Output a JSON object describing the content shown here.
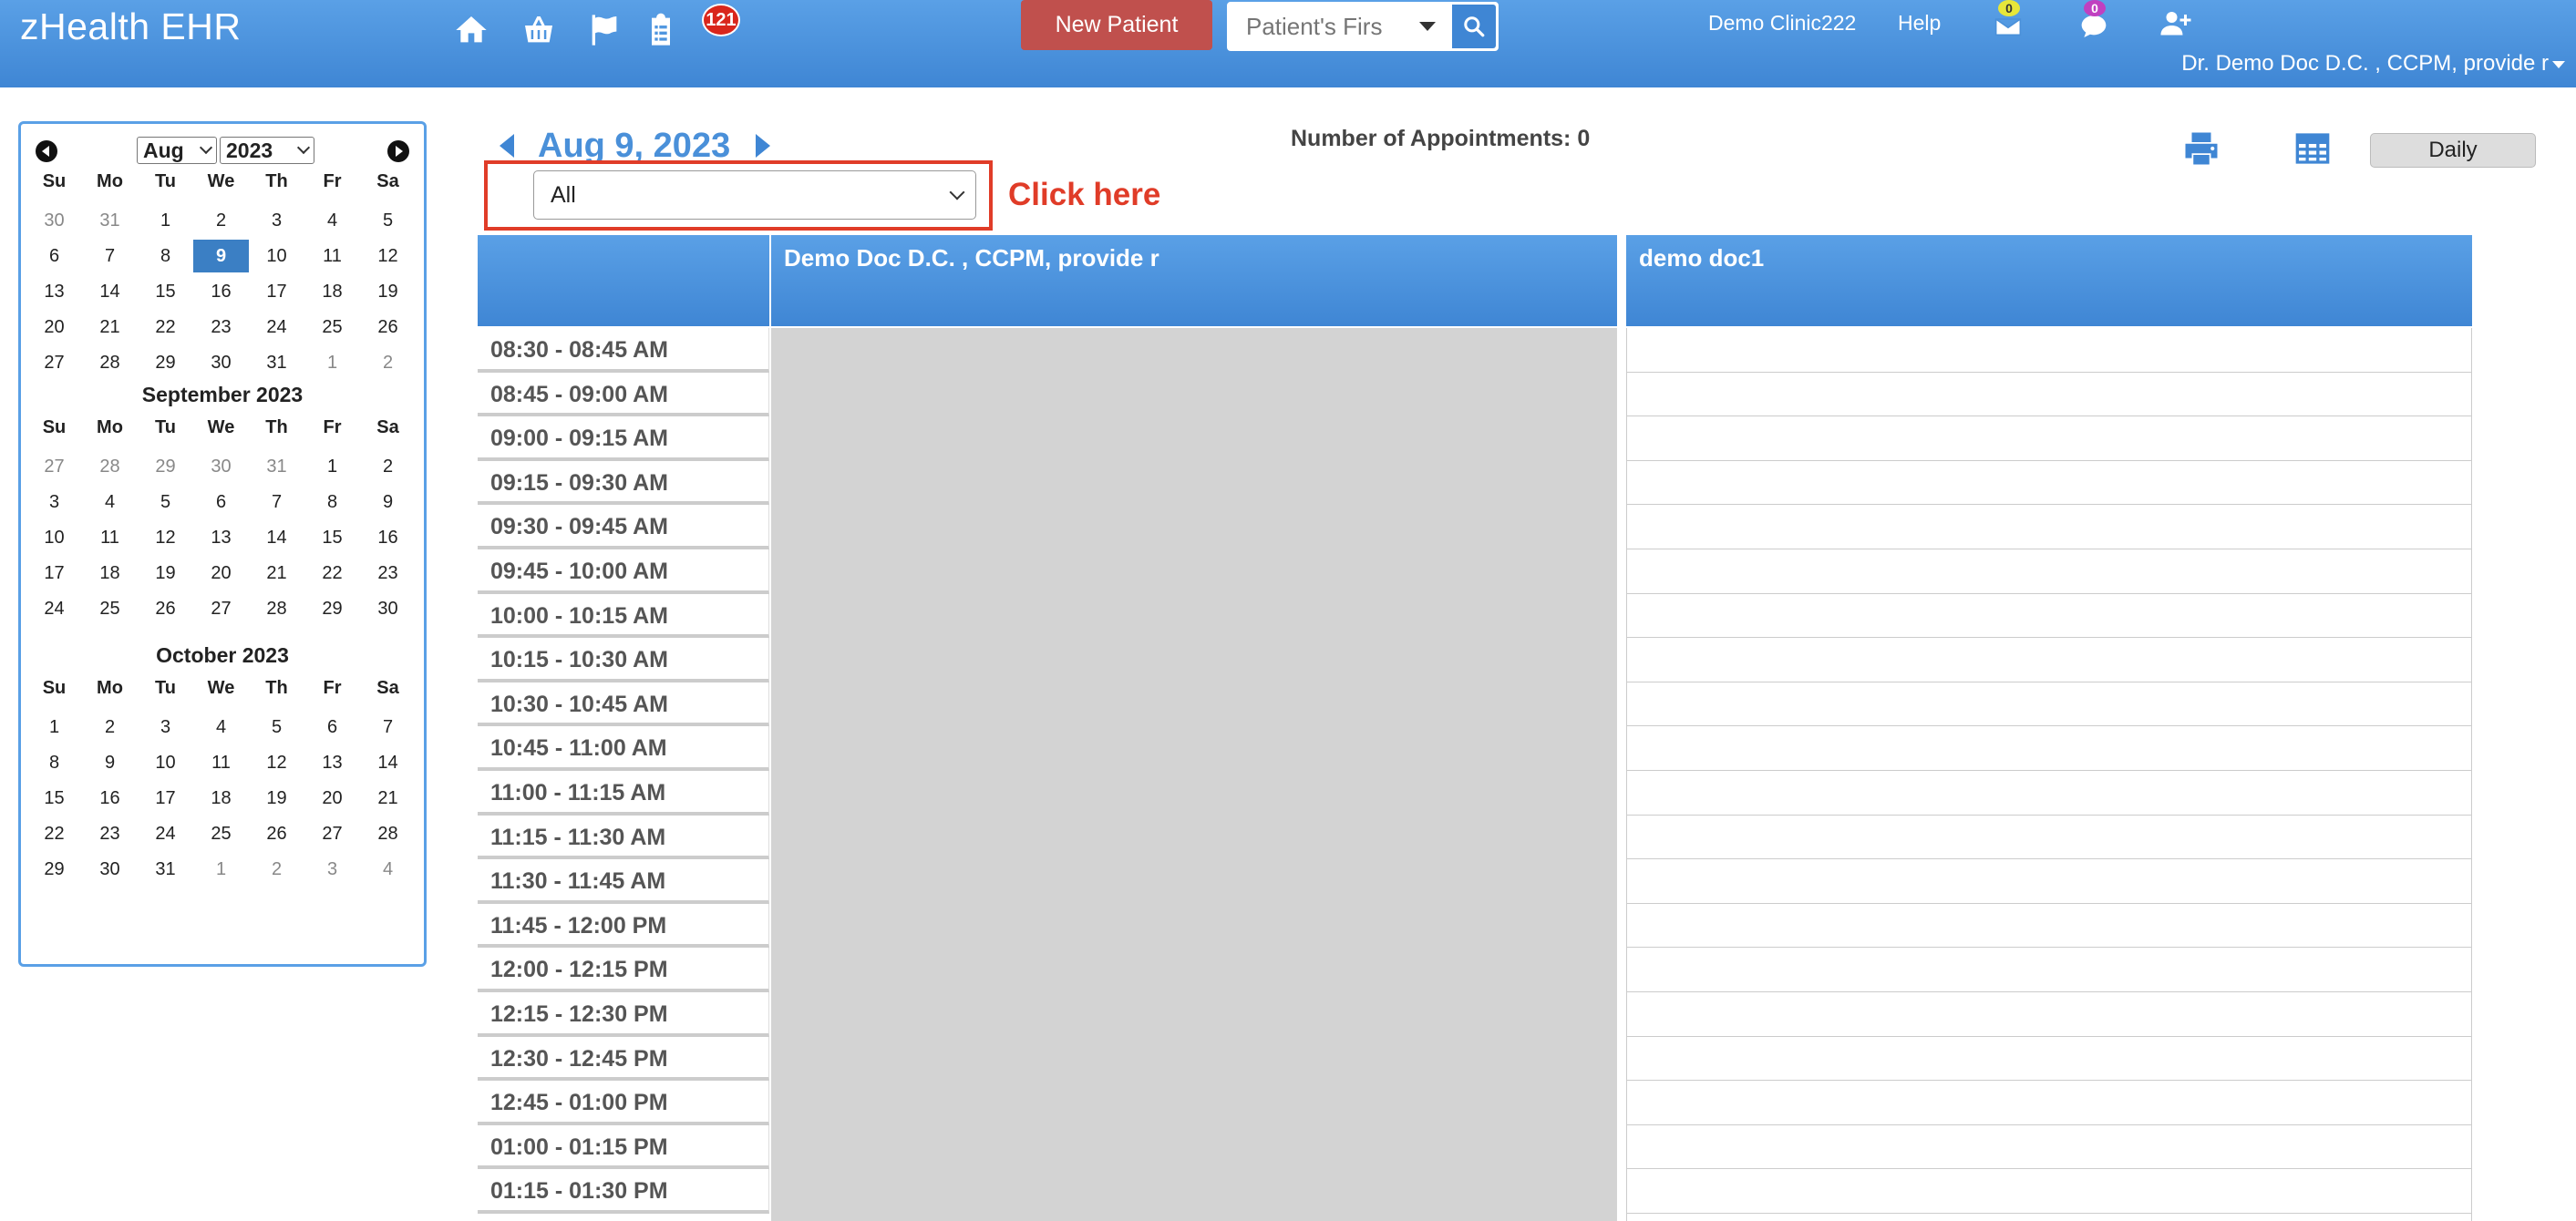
{
  "header": {
    "brand": "zHealth EHR",
    "notification_badge": "121",
    "new_patient_label": "New Patient",
    "search_placeholder": "Patient's Firs",
    "clinic": "Demo Clinic222",
    "help": "Help",
    "mail_badge": "0",
    "chat_badge": "0",
    "user": "Dr. Demo Doc D.C. , CCPM, provide r",
    "colors": {
      "bar": "#4a90d9",
      "new_patient": "#c0504d",
      "badge": "#d9261c"
    },
    "icons": [
      "home-icon",
      "basket-icon",
      "flag-icon",
      "clipboard-icon",
      "mail-icon",
      "chat-icon",
      "add-user-icon",
      "search-icon"
    ]
  },
  "mini_calendar": {
    "selected_month": "Aug",
    "selected_year": "2023",
    "dow": [
      "Su",
      "Mo",
      "Tu",
      "We",
      "Th",
      "Fr",
      "Sa"
    ],
    "months": [
      {
        "title": "",
        "weeks": [
          [
            {
              "d": "30",
              "m": 1
            },
            {
              "d": "31",
              "m": 1
            },
            {
              "d": "1"
            },
            {
              "d": "2"
            },
            {
              "d": "3"
            },
            {
              "d": "4"
            },
            {
              "d": "5"
            }
          ],
          [
            {
              "d": "6"
            },
            {
              "d": "7"
            },
            {
              "d": "8"
            },
            {
              "d": "9",
              "sel": 1
            },
            {
              "d": "10"
            },
            {
              "d": "11"
            },
            {
              "d": "12"
            }
          ],
          [
            {
              "d": "13"
            },
            {
              "d": "14"
            },
            {
              "d": "15"
            },
            {
              "d": "16"
            },
            {
              "d": "17"
            },
            {
              "d": "18"
            },
            {
              "d": "19"
            }
          ],
          [
            {
              "d": "20"
            },
            {
              "d": "21"
            },
            {
              "d": "22"
            },
            {
              "d": "23"
            },
            {
              "d": "24"
            },
            {
              "d": "25"
            },
            {
              "d": "26"
            }
          ],
          [
            {
              "d": "27"
            },
            {
              "d": "28"
            },
            {
              "d": "29"
            },
            {
              "d": "30"
            },
            {
              "d": "31"
            },
            {
              "d": "1",
              "m": 1
            },
            {
              "d": "2",
              "m": 1
            }
          ]
        ]
      },
      {
        "title": "September 2023",
        "weeks": [
          [
            {
              "d": "27",
              "m": 1
            },
            {
              "d": "28",
              "m": 1
            },
            {
              "d": "29",
              "m": 1
            },
            {
              "d": "30",
              "m": 1
            },
            {
              "d": "31",
              "m": 1
            },
            {
              "d": "1"
            },
            {
              "d": "2"
            }
          ],
          [
            {
              "d": "3"
            },
            {
              "d": "4"
            },
            {
              "d": "5"
            },
            {
              "d": "6"
            },
            {
              "d": "7"
            },
            {
              "d": "8"
            },
            {
              "d": "9"
            }
          ],
          [
            {
              "d": "10"
            },
            {
              "d": "11"
            },
            {
              "d": "12"
            },
            {
              "d": "13"
            },
            {
              "d": "14"
            },
            {
              "d": "15"
            },
            {
              "d": "16"
            }
          ],
          [
            {
              "d": "17"
            },
            {
              "d": "18"
            },
            {
              "d": "19"
            },
            {
              "d": "20"
            },
            {
              "d": "21"
            },
            {
              "d": "22"
            },
            {
              "d": "23"
            }
          ],
          [
            {
              "d": "24"
            },
            {
              "d": "25"
            },
            {
              "d": "26"
            },
            {
              "d": "27"
            },
            {
              "d": "28"
            },
            {
              "d": "29"
            },
            {
              "d": "30"
            }
          ]
        ]
      },
      {
        "title": "October 2023",
        "weeks": [
          [
            {
              "d": "1"
            },
            {
              "d": "2"
            },
            {
              "d": "3"
            },
            {
              "d": "4"
            },
            {
              "d": "5"
            },
            {
              "d": "6"
            },
            {
              "d": "7"
            }
          ],
          [
            {
              "d": "8"
            },
            {
              "d": "9"
            },
            {
              "d": "10"
            },
            {
              "d": "11"
            },
            {
              "d": "12"
            },
            {
              "d": "13"
            },
            {
              "d": "14"
            }
          ],
          [
            {
              "d": "15"
            },
            {
              "d": "16"
            },
            {
              "d": "17"
            },
            {
              "d": "18"
            },
            {
              "d": "19"
            },
            {
              "d": "20"
            },
            {
              "d": "21"
            }
          ],
          [
            {
              "d": "22"
            },
            {
              "d": "23"
            },
            {
              "d": "24"
            },
            {
              "d": "25"
            },
            {
              "d": "26"
            },
            {
              "d": "27"
            },
            {
              "d": "28"
            }
          ],
          [
            {
              "d": "29"
            },
            {
              "d": "30"
            },
            {
              "d": "31"
            },
            {
              "d": "1",
              "m": 1
            },
            {
              "d": "2",
              "m": 1
            },
            {
              "d": "3",
              "m": 1
            },
            {
              "d": "4",
              "m": 1
            }
          ]
        ]
      }
    ]
  },
  "main": {
    "date_label": "Aug 9, 2023",
    "appointments_text": "Number of Appointments: 0",
    "filter_value": "All",
    "annotation": "Click here",
    "view_label": "Daily",
    "icons": [
      "print-icon",
      "grid-icon"
    ]
  },
  "schedule": {
    "columns": [
      "Demo Doc D.C. , CCPM, provide r",
      "demo doc1"
    ],
    "times": [
      "08:30 - 08:45 AM",
      "08:45 - 09:00 AM",
      "09:00 - 09:15 AM",
      "09:15 - 09:30 AM",
      "09:30 - 09:45 AM",
      "09:45 - 10:00 AM",
      "10:00 - 10:15 AM",
      "10:15 - 10:30 AM",
      "10:30 - 10:45 AM",
      "10:45 - 11:00 AM",
      "11:00 - 11:15 AM",
      "11:15 - 11:30 AM",
      "11:30 - 11:45 AM",
      "11:45 - 12:00 PM",
      "12:00 - 12:15 PM",
      "12:15 - 12:30 PM",
      "12:30 - 12:45 PM",
      "12:45 - 01:00 PM",
      "01:00 - 01:15 PM",
      "01:15 - 01:30 PM"
    ]
  }
}
